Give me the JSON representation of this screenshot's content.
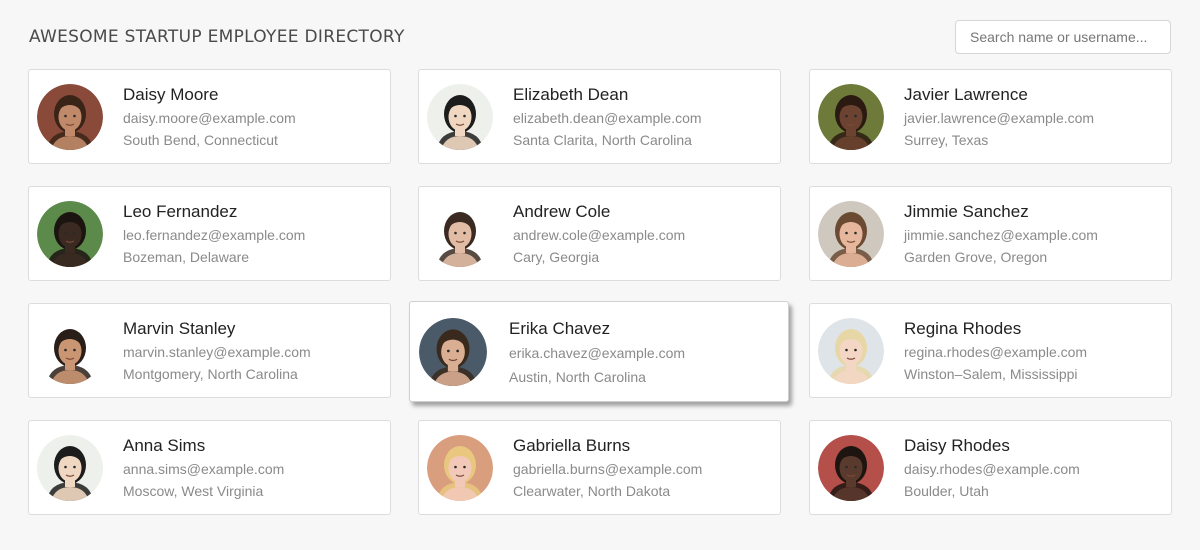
{
  "header": {
    "title": "AWESOME STARTUP EMPLOYEE DIRECTORY",
    "search_placeholder": "Search name or username..."
  },
  "employees": [
    {
      "name": "Daisy Moore",
      "email": "daisy.moore@example.com",
      "location": "South Bend, Connecticut",
      "skin": "#c08a6a",
      "hair": "#3a2418",
      "bg": "#8a4a3a"
    },
    {
      "name": "Elizabeth Dean",
      "email": "elizabeth.dean@example.com",
      "location": "Santa Clarita, North Carolina",
      "skin": "#f0d7c2",
      "hair": "#1c1c1c",
      "bg": "#eef0ec"
    },
    {
      "name": "Javier Lawrence",
      "email": "javier.lawrence@example.com",
      "location": "Surrey, Texas",
      "skin": "#6b4330",
      "hair": "#2a1a12",
      "bg": "#6d7a3a"
    },
    {
      "name": "Leo Fernandez",
      "email": "leo.fernandez@example.com",
      "location": "Bozeman, Delaware",
      "skin": "#3b2a22",
      "hair": "#1b1410",
      "bg": "#5c8a4a"
    },
    {
      "name": "Andrew Cole",
      "email": "andrew.cole@example.com",
      "location": "Cary, Georgia",
      "skin": "#e2bca4",
      "hair": "#3a2a22",
      "bg": "#ffffff"
    },
    {
      "name": "Jimmie Sanchez",
      "email": "jimmie.sanchez@example.com",
      "location": "Garden Grove, Oregon",
      "skin": "#e6b79c",
      "hair": "#6a4a32",
      "bg": "#cfc8bf"
    },
    {
      "name": "Marvin Stanley",
      "email": "marvin.stanley@example.com",
      "location": "Montgomery, North Carolina",
      "skin": "#c99572",
      "hair": "#2a1e18",
      "bg": "#ffffff"
    },
    {
      "name": "Erika Chavez",
      "email": "erika.chavez@example.com",
      "location": "Austin, North Carolina",
      "skin": "#d9ae92",
      "hair": "#3a2a1e",
      "bg": "#4a5a68"
    },
    {
      "name": "Regina Rhodes",
      "email": "regina.rhodes@example.com",
      "location": "Winston–Salem, Mississippi",
      "skin": "#f3d6c4",
      "hair": "#e8d7a6",
      "bg": "#dfe4e8"
    },
    {
      "name": "Anna Sims",
      "email": "anna.sims@example.com",
      "location": "Moscow, West Virginia",
      "skin": "#f0d7c2",
      "hair": "#1c1c1c",
      "bg": "#eef0ec"
    },
    {
      "name": "Gabriella Burns",
      "email": "gabriella.burns@example.com",
      "location": "Clearwater, North Dakota",
      "skin": "#f2c9b8",
      "hair": "#e9c77e",
      "bg": "#d99e7e"
    },
    {
      "name": "Daisy Rhodes",
      "email": "daisy.rhodes@example.com",
      "location": "Boulder, Utah",
      "skin": "#5a3a2c",
      "hair": "#1e1410",
      "bg": "#b44f4a"
    }
  ],
  "hovered_index": 7
}
